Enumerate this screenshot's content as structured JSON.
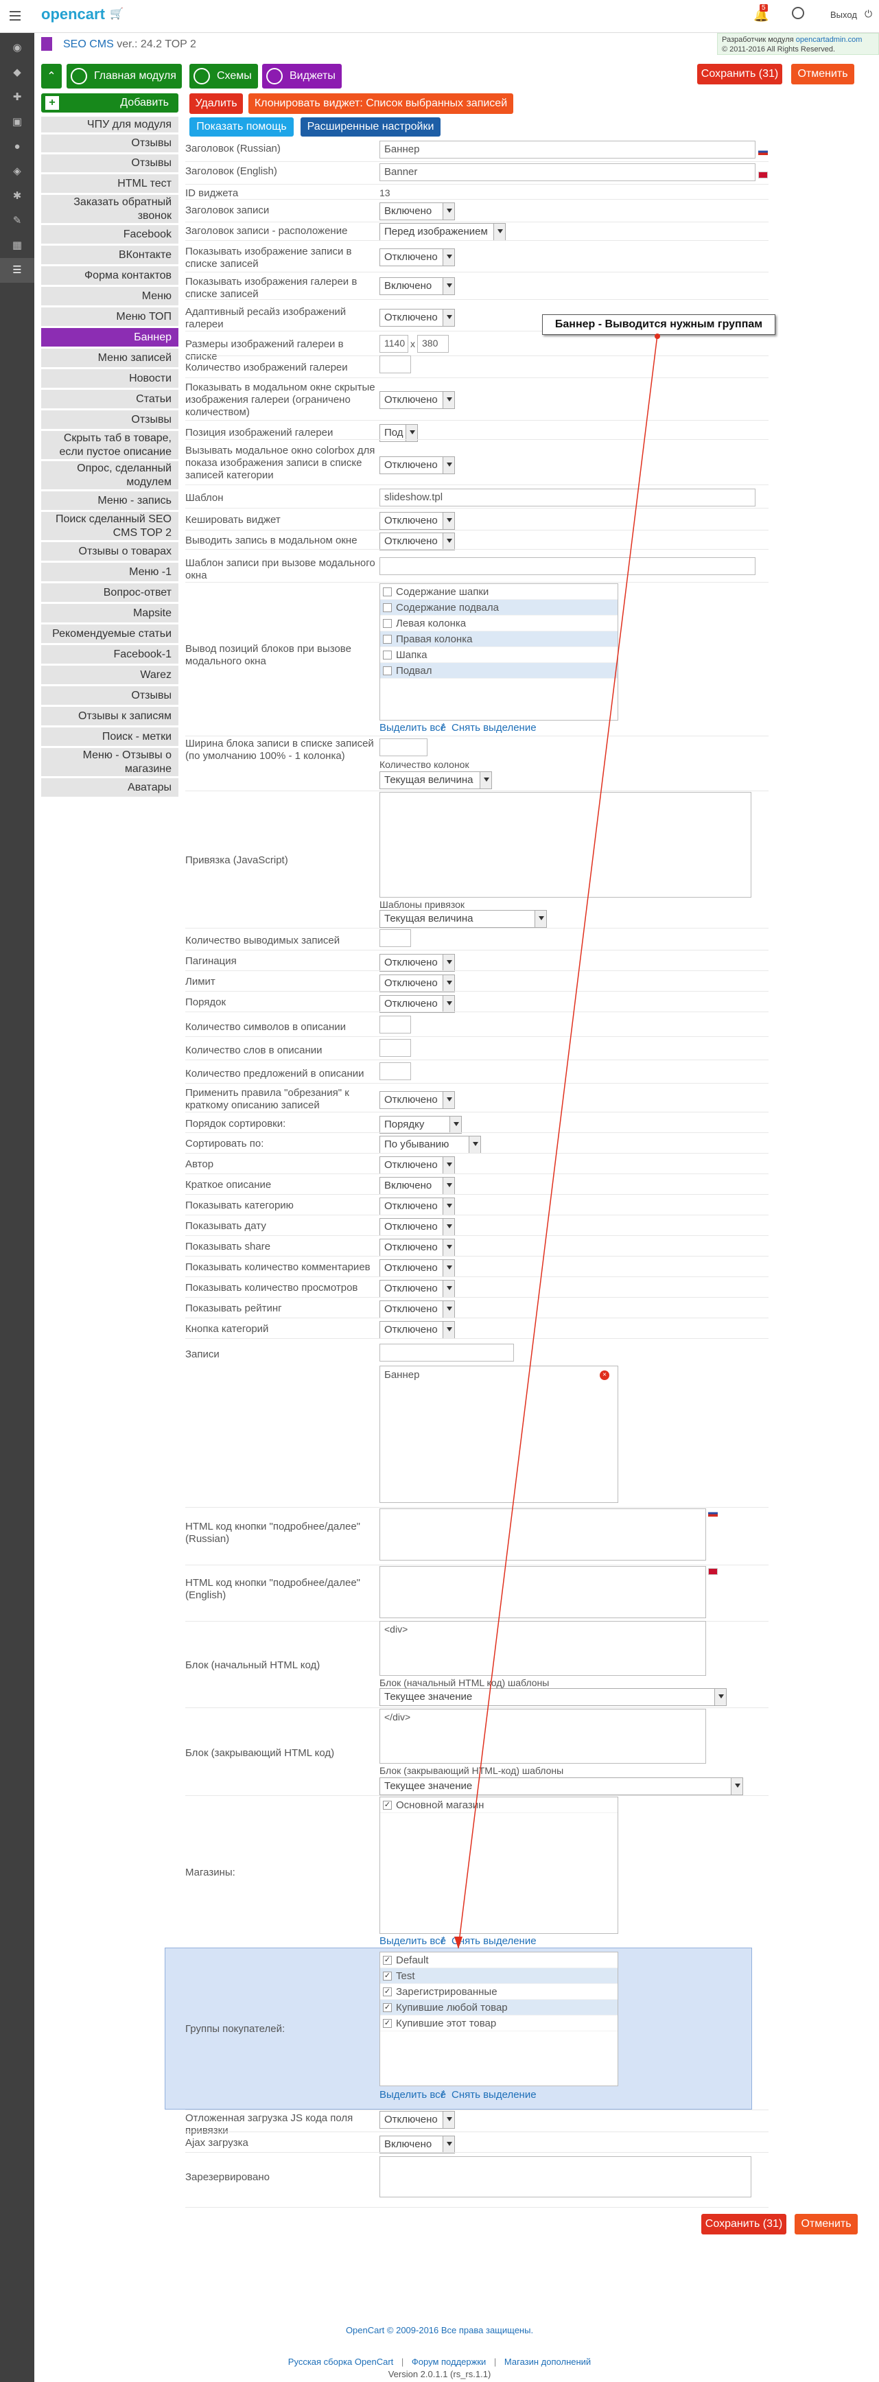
{
  "header": {
    "logo": "opencart",
    "notify_count": "5",
    "logout": "Выход",
    "dev_text": "Разработчик модуля",
    "dev_link": "opencartadmin.com",
    "copyright": "© 2011-2016 All Rights Reserved."
  },
  "title": {
    "name": "SEO CMS",
    "version": "ver.: 24.2 TOP 2"
  },
  "tabs": {
    "main": "Главная модуля",
    "schemes": "Схемы",
    "widgets": "Виджеты"
  },
  "actions": {
    "save": "Сохранить (31)",
    "cancel": "Отменить",
    "add": "Добавить",
    "delete": "Удалить",
    "clone": "Клонировать виджет: Список выбранных записей",
    "help": "Показать помощь",
    "advanced": "Расширенные настройки"
  },
  "sidebar": [
    "ЧПУ для модуля",
    "Отзывы",
    "Отзывы",
    "HTML тест",
    "Заказать обратный звонок",
    "Facebook",
    "ВКонтакте",
    "Форма контактов",
    "Меню",
    "Меню ТОП",
    "Баннер",
    "Меню записей",
    "Новости",
    "Статьи",
    "Отзывы",
    "Скрыть таб в товаре, если пустое описание",
    "Опрос, сделанный модулем",
    "Меню - запись",
    "Поиск сделанный SEO CMS TOP 2",
    "Отзывы о товарах",
    "Меню -1",
    "Вопрос-ответ",
    "Mapsite",
    "Рекомендуемые статьи",
    "Facebook-1",
    "Warez",
    "Отзывы",
    "Отзывы к записям",
    "Поиск - метки",
    "Меню - Отзывы о магазине",
    "Аватары"
  ],
  "annotation": "Баннер - Выводится нужным группам",
  "form": {
    "title_ru": {
      "label": "Заголовок (Russian)",
      "value": "Баннер"
    },
    "title_en": {
      "label": "Заголовок (English)",
      "value": "Banner"
    },
    "widget_id": {
      "label": "ID виджета",
      "value": "13"
    },
    "rec_title": {
      "label": "Заголовок записи",
      "value": "Включено"
    },
    "rec_title_pos": {
      "label": "Заголовок записи - расположение",
      "value": "Перед изображением"
    },
    "show_img_list": {
      "label": "Показывать изображение записи в списке записей",
      "value": "Отключено"
    },
    "show_gallery_list": {
      "label": "Показывать изображения галереи в списке записей",
      "value": "Включено"
    },
    "adaptive": {
      "label": "Адаптивный ресайз изображений галереи",
      "value": "Отключено"
    },
    "gallery_size": {
      "label": "Размеры изображений галереи в списке",
      "w": "1140",
      "x": "x",
      "h": "380"
    },
    "gallery_count": {
      "label": "Количество изображений галереи",
      "value": ""
    },
    "modal_hidden": {
      "label": "Показывать в модальном окне скрытые изображения галереи (ограничено количеством)",
      "value": "Отключено"
    },
    "gallery_pos": {
      "label": "Позиция изображений галереи",
      "value": "Под"
    },
    "colorbox": {
      "label": "Вызывать модальное окно colorbox для показа изображения записи в списке записей категории",
      "value": "Отключено"
    },
    "template": {
      "label": "Шаблон",
      "value": "slideshow.tpl"
    },
    "cache": {
      "label": "Кешировать виджет",
      "value": "Отключено"
    },
    "modal_out": {
      "label": "Выводить запись в модальном окне",
      "value": "Отключено"
    },
    "modal_tpl": {
      "label": "Шаблон записи при вызове модального окна",
      "value": ""
    },
    "positions": {
      "label": "Вывод позиций блоков при вызове модального окна",
      "items": [
        "Содержание шапки",
        "Содержание подвала",
        "Левая колонка",
        "Правая колонка",
        "Шапка",
        "Подвал"
      ],
      "select_all": "Выделить всё",
      "sep": "/",
      "deselect": "Снять выделение"
    },
    "width": {
      "label": "Ширина блока записи в списке записей (по умолчанию 100% - 1 колонка)",
      "value": "",
      "col_label": "Количество колонок",
      "col_value": "Текущая величина"
    },
    "js": {
      "label": "Привязка (JavaScript)",
      "tpl_label": "Шаблоны привязок",
      "tpl_value": "Текущая величина"
    },
    "count": {
      "label": "Количество выводимых записей",
      "value": ""
    },
    "pagination": {
      "label": "Пагинация",
      "value": "Отключено"
    },
    "limit": {
      "label": "Лимит",
      "value": "Отключено"
    },
    "order": {
      "label": "Порядок",
      "value": "Отключено"
    },
    "chars": {
      "label": "Количество символов в описании",
      "value": ""
    },
    "words": {
      "label": "Количество слов в описании",
      "value": ""
    },
    "sentences": {
      "label": "Количество предложений в описании",
      "value": ""
    },
    "trim": {
      "label": "Применить правила \"обрезания\" к краткому описанию записей",
      "value": "Отключено"
    },
    "sort_order": {
      "label": "Порядок сортировки:",
      "value": "Порядку"
    },
    "sort_by": {
      "label": "Сортировать по:",
      "value": "По убыванию"
    },
    "author": {
      "label": "Автор",
      "value": "Отключено"
    },
    "short_desc": {
      "label": "Краткое описание",
      "value": "Включено"
    },
    "show_cat": {
      "label": "Показывать категорию",
      "value": "Отключено"
    },
    "show_date": {
      "label": "Показывать дату",
      "value": "Отключено"
    },
    "show_share": {
      "label": "Показывать share",
      "value": "Отключено"
    },
    "show_comments": {
      "label": "Показывать количество комментариев",
      "value": "Отключено"
    },
    "show_views": {
      "label": "Показывать количество просмотров",
      "value": "Отключено"
    },
    "show_rating": {
      "label": "Показывать рейтинг",
      "value": "Отключено"
    },
    "cat_button": {
      "label": "Кнопка категорий",
      "value": "Отключено"
    },
    "records": {
      "label": "Записи",
      "value": "",
      "item": "Баннер"
    },
    "more_ru": {
      "label": "HTML код кнопки \"подробнее/далее\" (Russian)",
      "value": ""
    },
    "more_en": {
      "label": "HTML код кнопки \"подробнее/далее\" (English)",
      "value": ""
    },
    "block_start": {
      "label": "Блок (начальный HTML код)",
      "value": "<div>",
      "tpl_label": "Блок (начальный HTML код) шаблоны",
      "tpl_value": "Текущее значение"
    },
    "block_end": {
      "label": "Блок (закрывающий HTML код)",
      "value": "</div>",
      "tpl_label": "Блок (закрывающий HTML-код) шаблоны",
      "tpl_value": "Текущее значение"
    },
    "stores": {
      "label": "Магазины:",
      "items": [
        "Основной магазин"
      ],
      "select_all": "Выделить всё",
      "sep": "/",
      "deselect": "Снять выделение"
    },
    "groups": {
      "label": "Группы покупателей:",
      "items": [
        "Default",
        "Test",
        "Зарегистрированные",
        "Купившие любой товар",
        "Купившие этот товар"
      ],
      "select_all": "Выделить всё",
      "sep": "/",
      "deselect": "Снять выделение"
    },
    "lazy_js": {
      "label": "Отложенная загрузка JS кода поля привязки",
      "value": "Отключено"
    },
    "ajax": {
      "label": "Ajax загрузка",
      "value": "Включено"
    },
    "reserved": {
      "label": "Зарезервировано",
      "value": ""
    }
  },
  "footer": {
    "copyright": "OpenCart © 2009-2016 Все права защищены.",
    "link1": "Русская сборка OpenCart",
    "sep1": "|",
    "link2": "Форум поддержки",
    "sep2": "|",
    "link3": "Магазин дополнений",
    "version": "Version 2.0.1.1 (rs_rs.1.1)"
  },
  "colors": {
    "accent": "#8c2db3",
    "save": "#e0301e",
    "cancel": "#f0541e",
    "green": "#17881b",
    "highlight": "#cfdff5"
  }
}
